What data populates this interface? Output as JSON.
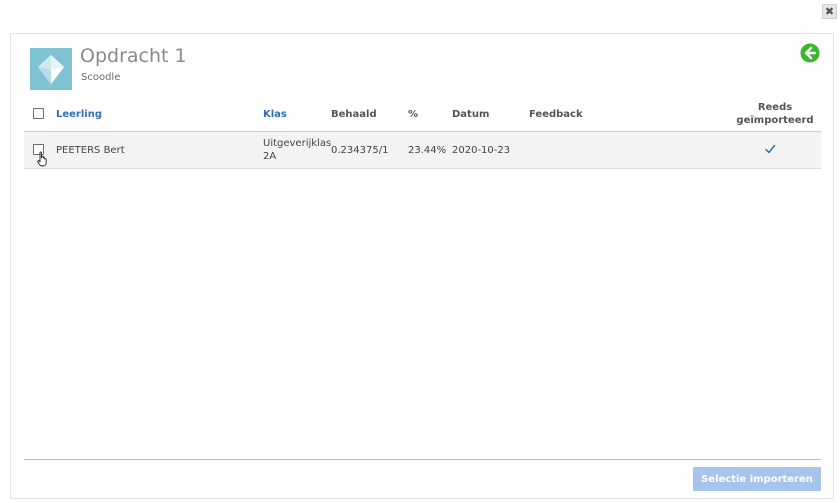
{
  "window": {
    "close_label": "✖"
  },
  "header": {
    "title": "Opdracht 1",
    "subtitle": "Scoodle"
  },
  "table": {
    "columns": {
      "leerling": "Leerling",
      "klas": "Klas",
      "behaald": "Behaald",
      "percent": "%",
      "datum": "Datum",
      "feedback": "Feedback",
      "reeds_line1": "Reeds",
      "reeds_line2": "geïmporteerd"
    },
    "rows": [
      {
        "leerling": "PEETERS Bert",
        "klas_line1": "Uitgeverijklas",
        "klas_line2": "2A",
        "behaald": "0.234375/1",
        "percent": "23.44%",
        "datum": "2020-10-23",
        "feedback": "",
        "already_imported": true
      }
    ]
  },
  "footer": {
    "import_button": "Selectie importeren"
  },
  "colors": {
    "link_blue": "#2e6fb5",
    "import_button_bg": "#a7c4ec",
    "back_arrow_green": "#3bb52c",
    "logo_bg": "#7fc3d3"
  }
}
